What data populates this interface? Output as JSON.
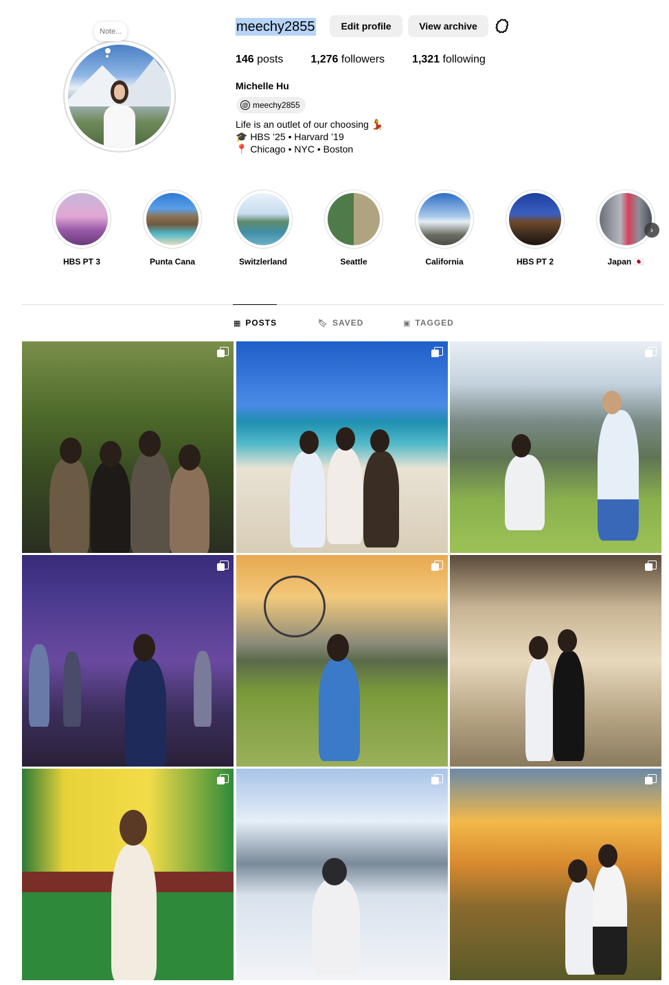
{
  "profile": {
    "username": "meechy2855",
    "edit_label": "Edit profile",
    "archive_label": "View archive",
    "note": "Note...",
    "posts_count": "146",
    "posts_label": "posts",
    "followers_count": "1,276",
    "followers_label": "followers",
    "following_count": "1,321",
    "following_label": "following",
    "full_name": "Michelle Hu",
    "threads_handle": "meechy2855",
    "bio_line1": "Life is an outlet of our choosing 💃",
    "bio_line2": "🎓 HBS ’25 • Harvard ’19",
    "bio_line3": "📍 Chicago • NYC • Boston"
  },
  "highlights": [
    {
      "label": "HBS PT 3"
    },
    {
      "label": "Punta Cana"
    },
    {
      "label": "Switzlerland"
    },
    {
      "label": "Seattle"
    },
    {
      "label": "California"
    },
    {
      "label": "HBS PT 2"
    },
    {
      "label": "Japan 🇯🇵"
    }
  ],
  "tabs": [
    {
      "label": "POSTS",
      "icon": "grid-icon"
    },
    {
      "label": "SAVED",
      "icon": "bookmark-icon"
    },
    {
      "label": "TAGGED",
      "icon": "tag-icon"
    }
  ],
  "colors": {
    "button_bg": "#efefef",
    "divider": "#dbdbdb",
    "selection": "#b7d4f7",
    "muted": "#737373"
  }
}
